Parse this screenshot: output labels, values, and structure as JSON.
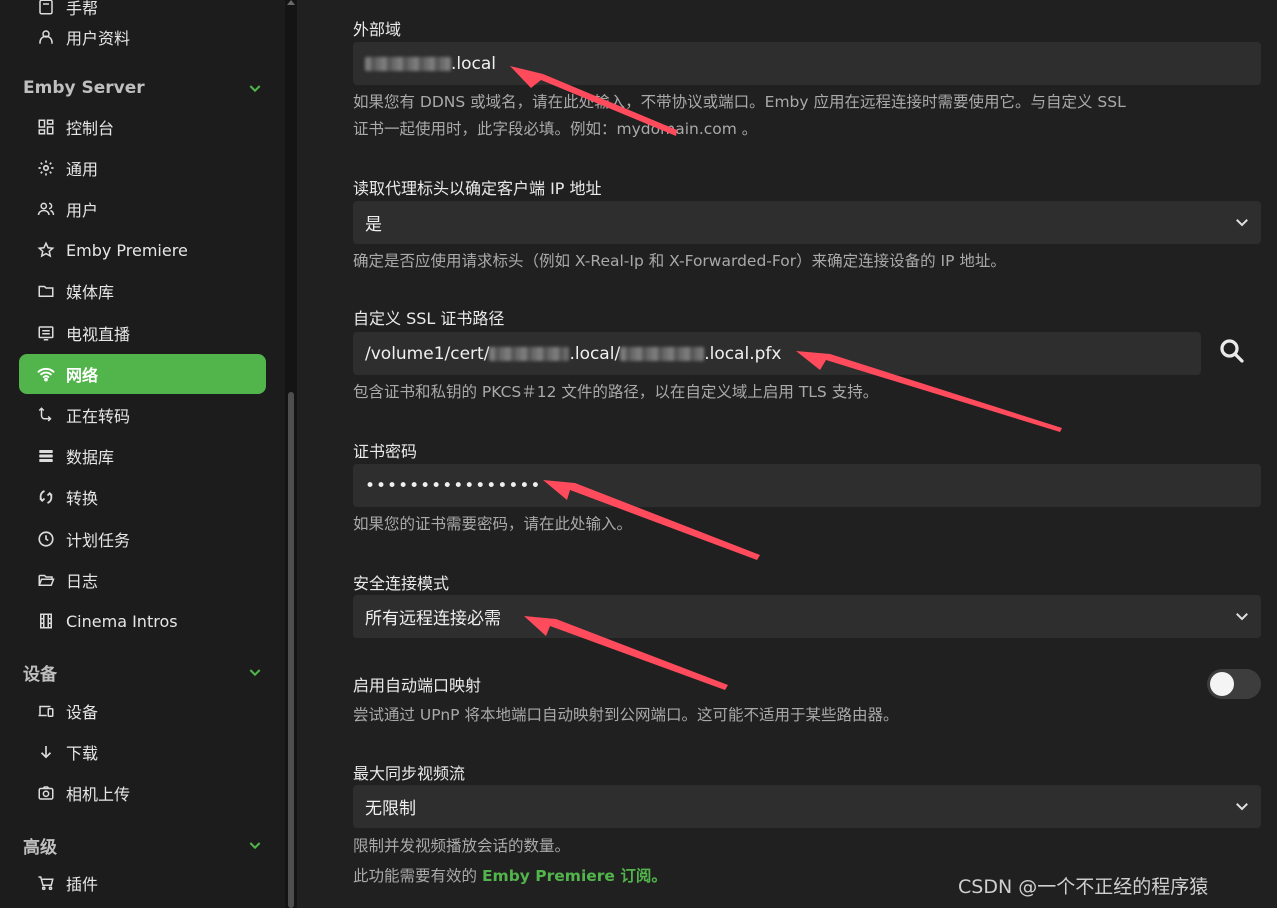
{
  "sidebar": {
    "top_items": [
      {
        "label": "手帮",
        "icon": "book-icon"
      },
      {
        "label": "用户资料",
        "icon": "person-icon"
      }
    ],
    "sections": [
      {
        "title": "Emby Server",
        "items": [
          {
            "label": "控制台",
            "icon": "dashboard-icon"
          },
          {
            "label": "通用",
            "icon": "gear-icon"
          },
          {
            "label": "用户",
            "icon": "people-icon"
          },
          {
            "label": "Emby Premiere",
            "icon": "star-icon"
          },
          {
            "label": "媒体库",
            "icon": "folder-icon"
          },
          {
            "label": "电视直播",
            "icon": "tv-guide-icon"
          },
          {
            "label": "网络",
            "icon": "wifi-icon",
            "active": true
          },
          {
            "label": "正在转码",
            "icon": "transcode-icon"
          },
          {
            "label": "数据库",
            "icon": "database-icon"
          },
          {
            "label": "转换",
            "icon": "sync-icon"
          },
          {
            "label": "计划任务",
            "icon": "clock-icon"
          },
          {
            "label": "日志",
            "icon": "folder-open-icon"
          },
          {
            "label": "Cinema Intros",
            "icon": "film-icon"
          }
        ]
      },
      {
        "title": "设备",
        "items": [
          {
            "label": "设备",
            "icon": "devices-icon"
          },
          {
            "label": "下载",
            "icon": "download-icon"
          },
          {
            "label": "相机上传",
            "icon": "camera-icon"
          }
        ]
      },
      {
        "title": "高级",
        "items": [
          {
            "label": "插件",
            "icon": "cart-icon"
          }
        ]
      }
    ]
  },
  "main": {
    "external_domain": {
      "label": "外部域",
      "value_suffix": ".local",
      "description_1": "如果您有 DDNS 或域名，请在此处输入，不带协议或端口。Emby 应用在远程连接时需要使用它。与自定义 SSL",
      "description_2": "证书一起使用时，此字段必填。例如：mydomain.com 。"
    },
    "proxy_header": {
      "label": "读取代理标头以确定客户端 IP 地址",
      "value": "是",
      "description": "确定是否应使用请求标头（例如 X-Real-Ip 和 X-Forwarded-For）来确定连接设备的 IP 地址。"
    },
    "ssl_cert_path": {
      "label": "自定义 SSL 证书路径",
      "value_part1": "/volume1/cert/",
      "value_part2": ".local/",
      "value_part3": ".local.pfx",
      "description": "包含证书和私钥的 PKCS＃12 文件的路径，以在自定义域上启用 TLS 支持。"
    },
    "cert_password": {
      "label": "证书密码",
      "value": "••••••••••••••••",
      "description": "如果您的证书需要密码，请在此处输入。"
    },
    "secure_connection_mode": {
      "label": "安全连接模式",
      "value": "所有远程连接必需"
    },
    "upnp": {
      "label": "启用自动端口映射",
      "enabled": false,
      "description": "尝试通过 UPnP 将本地端口自动映射到公网端口。这可能不适用于某些路由器。"
    },
    "max_streams": {
      "label": "最大同步视频流",
      "value": "无限制",
      "description": "限制并发视频播放会话的数量。",
      "premiere_prefix": "此功能需要有效的",
      "premiere_link": "Emby Premiere 订阅",
      "premiere_suffix": "。"
    }
  },
  "watermark": "CSDN @一个不正经的程序猿",
  "colors": {
    "accent": "#52b54b",
    "annotation_arrow": "#ff4b5c",
    "background": "#202020"
  }
}
